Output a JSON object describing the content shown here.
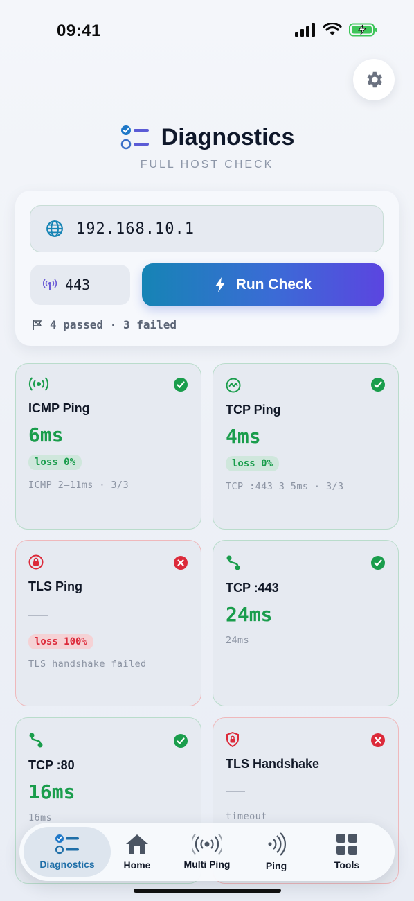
{
  "status_bar": {
    "time": "09:41"
  },
  "header": {
    "title": "Diagnostics",
    "subtitle": "FULL HOST CHECK"
  },
  "input": {
    "host_value": "192.168.10.1",
    "port_value": "443",
    "run_label": "Run Check",
    "summary": "4 passed · 3 failed"
  },
  "colors": {
    "accent": "#1684b5",
    "accent_end": "#5b45e0",
    "pass": "#1a9d4c",
    "fail": "#dc2a3a"
  },
  "cards": [
    {
      "title": "ICMP Ping",
      "value": "6ms",
      "badge": "loss 0%",
      "detail": "ICMP 2–11ms · 3/3",
      "status": "pass",
      "icon": "broadcast-icon"
    },
    {
      "title": "TCP Ping",
      "value": "4ms",
      "badge": "loss 0%",
      "detail": "TCP :443 3–5ms · 3/3",
      "status": "pass",
      "icon": "pulse-icon"
    },
    {
      "title": "TLS Ping",
      "value": "—",
      "badge": "loss 100%",
      "detail": "TLS handshake failed",
      "status": "fail",
      "icon": "lock-icon"
    },
    {
      "title": "TCP :443",
      "value": "24ms",
      "detail": "24ms",
      "status": "pass",
      "icon": "route-icon"
    },
    {
      "title": "TCP :80",
      "value": "16ms",
      "detail": "16ms",
      "status": "pass",
      "icon": "route-icon"
    },
    {
      "title": "TLS Handshake",
      "value": "—",
      "detail": "timeout",
      "status": "fail",
      "icon": "shield-lock-icon"
    }
  ],
  "tabs": [
    {
      "label": "Diagnostics",
      "icon": "checklist-icon",
      "active": true
    },
    {
      "label": "Home",
      "icon": "home-icon"
    },
    {
      "label": "Multi Ping",
      "icon": "broadcast-icon"
    },
    {
      "label": "Ping",
      "icon": "signal-waves-icon"
    },
    {
      "label": "Tools",
      "icon": "grid-icon"
    }
  ]
}
